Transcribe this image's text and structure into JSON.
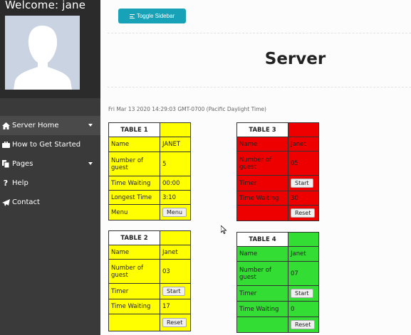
{
  "sidebar": {
    "welcome": "Welcome: jane",
    "items": [
      {
        "label": "Server Home",
        "icon": "home-icon",
        "has_caret": true
      },
      {
        "label": "How to Get Started",
        "icon": "briefcase-icon",
        "has_caret": false
      },
      {
        "label": "Pages",
        "icon": "copy-icon",
        "has_caret": true
      },
      {
        "label": "Help",
        "icon": "question-icon",
        "has_caret": false
      },
      {
        "label": "Contact",
        "icon": "send-icon",
        "has_caret": false
      }
    ]
  },
  "toolbar": {
    "toggle_label": "Toggle Sidebar"
  },
  "page": {
    "title": "Server",
    "timestamp": "Fri Mar 13 2020 14:29:03 GMT-0700 (Pacific Daylight Time)"
  },
  "tables": {
    "t1": {
      "name": "TABLE 1",
      "color": "#ffff00",
      "rows": [
        {
          "label": "Name",
          "value": "JANET"
        },
        {
          "label": "Number of guest",
          "value": "5"
        },
        {
          "label": "Time Waiting",
          "value": "00:00"
        },
        {
          "label": "Longest Time",
          "value": "3:10"
        },
        {
          "label": "Menu",
          "button": "Menu"
        }
      ]
    },
    "t2": {
      "name": "TABLE 2",
      "color": "#ffff00",
      "rows": [
        {
          "label": "Name",
          "value": "Janet"
        },
        {
          "label": "Number of guest",
          "value": "03"
        },
        {
          "label": "Timer",
          "button": "Start"
        },
        {
          "label": "Time Waiting",
          "value": "17"
        },
        {
          "label": "",
          "button": "Reset"
        }
      ]
    },
    "t3": {
      "name": "TABLE 3",
      "color": "#ee0000",
      "rows": [
        {
          "label": "Name",
          "value": "Janet"
        },
        {
          "label": "Number of guest",
          "value": "05"
        },
        {
          "label": "Timer",
          "button": "Start"
        },
        {
          "label": "Time Waiting",
          "value": "30"
        },
        {
          "label": "",
          "button": "Reset"
        }
      ]
    },
    "t4": {
      "name": "TABLE 4",
      "color": "#33dd33",
      "rows": [
        {
          "label": "Name",
          "value": "Janet"
        },
        {
          "label": "Number of guest",
          "value": "07"
        },
        {
          "label": "Timer",
          "button": "Start"
        },
        {
          "label": "Time Waiting",
          "value": "0"
        },
        {
          "label": "",
          "button": "Reset"
        }
      ]
    }
  }
}
